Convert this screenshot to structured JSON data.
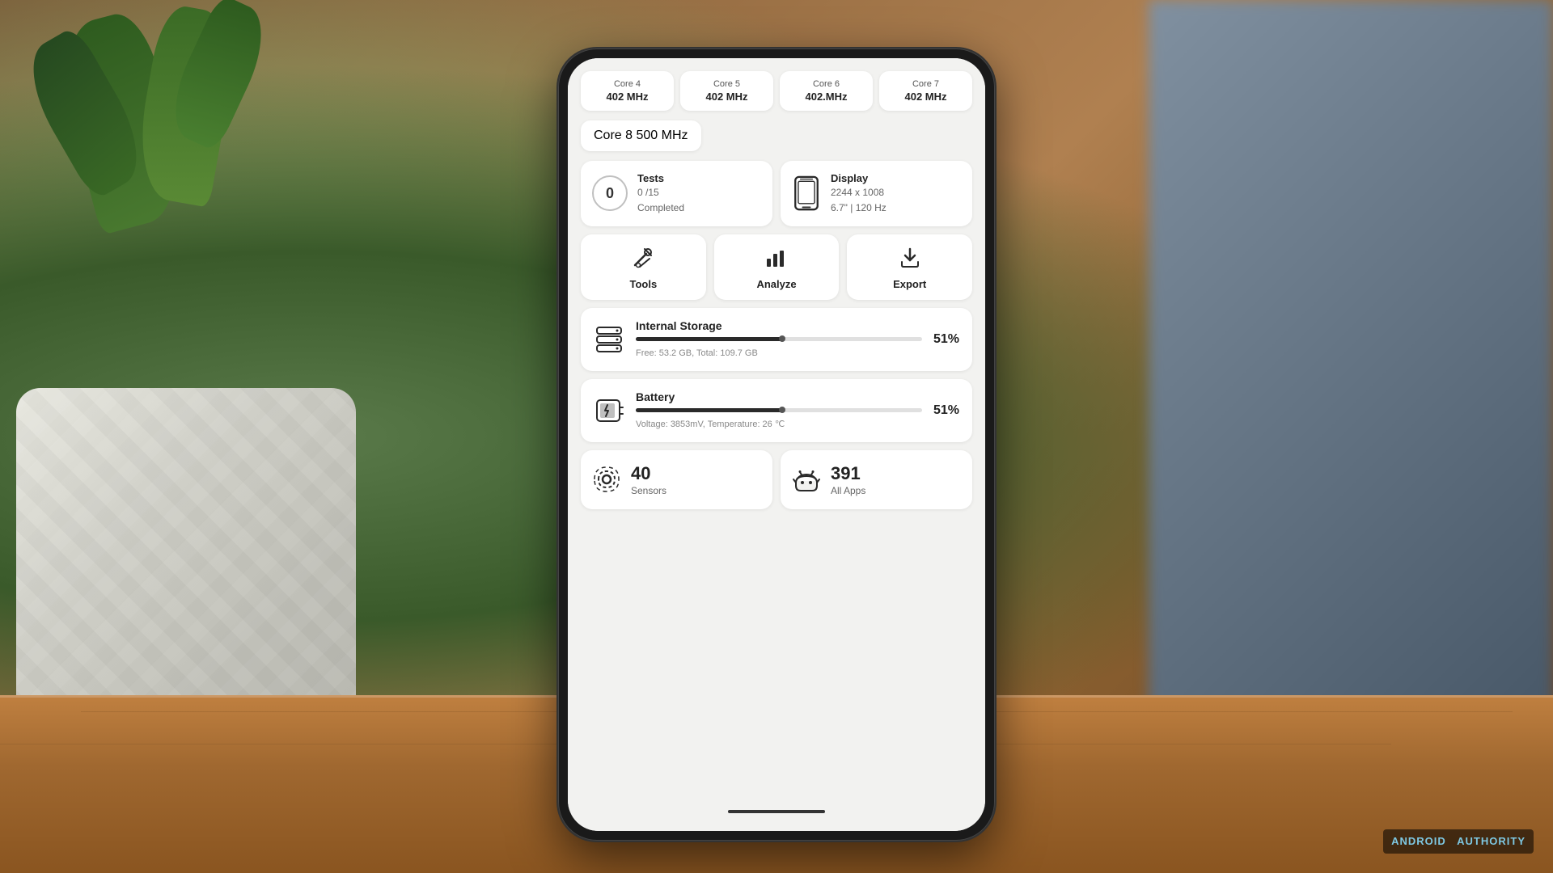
{
  "background": {
    "colors": {
      "wood": "#c08040",
      "plant_bg": "#4a7a30"
    }
  },
  "phone": {
    "cores": [
      {
        "label": "Core 4",
        "value": "402 MHz"
      },
      {
        "label": "Core 5",
        "value": "402 MHz"
      },
      {
        "label": "Core 6",
        "value": "402.MHz"
      },
      {
        "label": "Core 7",
        "value": "402 MHz"
      }
    ],
    "core8": {
      "label": "Core 8",
      "value": "500 MHz"
    },
    "tests": {
      "count": "0",
      "title": "Tests",
      "subtitle": "0 /15",
      "subtitle2": "Completed"
    },
    "display": {
      "title": "Display",
      "resolution": "2244 x 1008",
      "specs": "6.7\" | 120 Hz"
    },
    "tools": {
      "label": "Tools"
    },
    "analyze": {
      "label": "Analyze"
    },
    "export": {
      "label": "Export"
    },
    "storage": {
      "title": "Internal Storage",
      "free": "Free: 53.2 GB,  Total: 109.7 GB",
      "percent": "51%",
      "fill_pct": 51
    },
    "battery": {
      "title": "Battery",
      "details": "Voltage: 3853mV,  Temperature: 26 ℃",
      "percent": "51%",
      "fill_pct": 51
    },
    "sensors": {
      "count": "40",
      "label": "Sensors"
    },
    "all_apps": {
      "count": "391",
      "label": "All Apps"
    }
  },
  "watermark": {
    "brand": "ANDROID",
    "domain": "AUTHORITY"
  }
}
